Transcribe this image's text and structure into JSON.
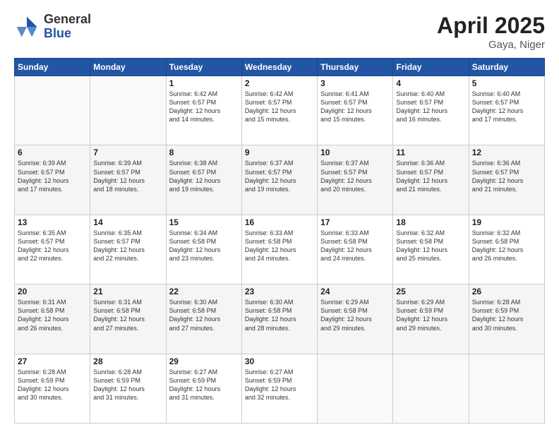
{
  "logo": {
    "general": "General",
    "blue": "Blue"
  },
  "title": {
    "month": "April 2025",
    "location": "Gaya, Niger"
  },
  "weekdays": [
    "Sunday",
    "Monday",
    "Tuesday",
    "Wednesday",
    "Thursday",
    "Friday",
    "Saturday"
  ],
  "weeks": [
    [
      {
        "day": "",
        "info": ""
      },
      {
        "day": "",
        "info": ""
      },
      {
        "day": "1",
        "info": "Sunrise: 6:42 AM\nSunset: 6:57 PM\nDaylight: 12 hours\nand 14 minutes."
      },
      {
        "day": "2",
        "info": "Sunrise: 6:42 AM\nSunset: 6:57 PM\nDaylight: 12 hours\nand 15 minutes."
      },
      {
        "day": "3",
        "info": "Sunrise: 6:41 AM\nSunset: 6:57 PM\nDaylight: 12 hours\nand 15 minutes."
      },
      {
        "day": "4",
        "info": "Sunrise: 6:40 AM\nSunset: 6:57 PM\nDaylight: 12 hours\nand 16 minutes."
      },
      {
        "day": "5",
        "info": "Sunrise: 6:40 AM\nSunset: 6:57 PM\nDaylight: 12 hours\nand 17 minutes."
      }
    ],
    [
      {
        "day": "6",
        "info": "Sunrise: 6:39 AM\nSunset: 6:57 PM\nDaylight: 12 hours\nand 17 minutes."
      },
      {
        "day": "7",
        "info": "Sunrise: 6:39 AM\nSunset: 6:57 PM\nDaylight: 12 hours\nand 18 minutes."
      },
      {
        "day": "8",
        "info": "Sunrise: 6:38 AM\nSunset: 6:57 PM\nDaylight: 12 hours\nand 19 minutes."
      },
      {
        "day": "9",
        "info": "Sunrise: 6:37 AM\nSunset: 6:57 PM\nDaylight: 12 hours\nand 19 minutes."
      },
      {
        "day": "10",
        "info": "Sunrise: 6:37 AM\nSunset: 6:57 PM\nDaylight: 12 hours\nand 20 minutes."
      },
      {
        "day": "11",
        "info": "Sunrise: 6:36 AM\nSunset: 6:57 PM\nDaylight: 12 hours\nand 21 minutes."
      },
      {
        "day": "12",
        "info": "Sunrise: 6:36 AM\nSunset: 6:57 PM\nDaylight: 12 hours\nand 21 minutes."
      }
    ],
    [
      {
        "day": "13",
        "info": "Sunrise: 6:35 AM\nSunset: 6:57 PM\nDaylight: 12 hours\nand 22 minutes."
      },
      {
        "day": "14",
        "info": "Sunrise: 6:35 AM\nSunset: 6:57 PM\nDaylight: 12 hours\nand 22 minutes."
      },
      {
        "day": "15",
        "info": "Sunrise: 6:34 AM\nSunset: 6:58 PM\nDaylight: 12 hours\nand 23 minutes."
      },
      {
        "day": "16",
        "info": "Sunrise: 6:33 AM\nSunset: 6:58 PM\nDaylight: 12 hours\nand 24 minutes."
      },
      {
        "day": "17",
        "info": "Sunrise: 6:33 AM\nSunset: 6:58 PM\nDaylight: 12 hours\nand 24 minutes."
      },
      {
        "day": "18",
        "info": "Sunrise: 6:32 AM\nSunset: 6:58 PM\nDaylight: 12 hours\nand 25 minutes."
      },
      {
        "day": "19",
        "info": "Sunrise: 6:32 AM\nSunset: 6:58 PM\nDaylight: 12 hours\nand 26 minutes."
      }
    ],
    [
      {
        "day": "20",
        "info": "Sunrise: 6:31 AM\nSunset: 6:58 PM\nDaylight: 12 hours\nand 26 minutes."
      },
      {
        "day": "21",
        "info": "Sunrise: 6:31 AM\nSunset: 6:58 PM\nDaylight: 12 hours\nand 27 minutes."
      },
      {
        "day": "22",
        "info": "Sunrise: 6:30 AM\nSunset: 6:58 PM\nDaylight: 12 hours\nand 27 minutes."
      },
      {
        "day": "23",
        "info": "Sunrise: 6:30 AM\nSunset: 6:58 PM\nDaylight: 12 hours\nand 28 minutes."
      },
      {
        "day": "24",
        "info": "Sunrise: 6:29 AM\nSunset: 6:58 PM\nDaylight: 12 hours\nand 29 minutes."
      },
      {
        "day": "25",
        "info": "Sunrise: 6:29 AM\nSunset: 6:59 PM\nDaylight: 12 hours\nand 29 minutes."
      },
      {
        "day": "26",
        "info": "Sunrise: 6:28 AM\nSunset: 6:59 PM\nDaylight: 12 hours\nand 30 minutes."
      }
    ],
    [
      {
        "day": "27",
        "info": "Sunrise: 6:28 AM\nSunset: 6:59 PM\nDaylight: 12 hours\nand 30 minutes."
      },
      {
        "day": "28",
        "info": "Sunrise: 6:28 AM\nSunset: 6:59 PM\nDaylight: 12 hours\nand 31 minutes."
      },
      {
        "day": "29",
        "info": "Sunrise: 6:27 AM\nSunset: 6:59 PM\nDaylight: 12 hours\nand 31 minutes."
      },
      {
        "day": "30",
        "info": "Sunrise: 6:27 AM\nSunset: 6:59 PM\nDaylight: 12 hours\nand 32 minutes."
      },
      {
        "day": "",
        "info": ""
      },
      {
        "day": "",
        "info": ""
      },
      {
        "day": "",
        "info": ""
      }
    ]
  ]
}
